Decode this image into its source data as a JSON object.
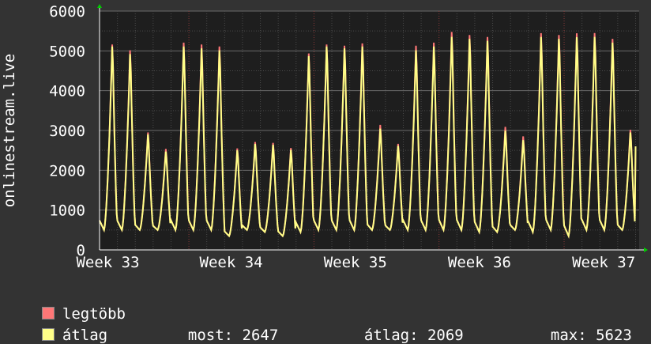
{
  "colors": {
    "background": "#333333",
    "plot_bg": "#1e1e1e",
    "grid": "#555555",
    "series_max": "#ff7777",
    "series_avg": "#ffff88",
    "arrow": "#00cc00"
  },
  "chart_data": {
    "type": "line",
    "ylabel": "onlinestream.live",
    "ylim": [
      0,
      6000
    ],
    "y_ticks": [
      "0",
      "1000",
      "2000",
      "3000",
      "4000",
      "5000",
      "6000"
    ],
    "x_ticks": [
      "Week 33",
      "Week 34",
      "Week 35",
      "Week 36",
      "Week 37"
    ],
    "x_unit": "day",
    "xlim": [
      0,
      30.2
    ],
    "grid": true,
    "legend_position": "bottom",
    "daily_peaks_max": [
      5350,
      5200,
      3050,
      2620,
      5400,
      5350,
      5300,
      2640,
      2800,
      2780,
      2650,
      5120,
      5350,
      5320,
      5380,
      3250,
      2750,
      5320,
      5400,
      5680,
      5600,
      5550,
      3200,
      2950,
      5650,
      5600,
      5650,
      5650,
      5500,
      3120
    ],
    "daily_peaks_avg": [
      5300,
      5100,
      3000,
      2550,
      5300,
      5250,
      5200,
      2590,
      2750,
      2730,
      2600,
      5050,
      5300,
      5250,
      5300,
      3150,
      2700,
      5200,
      5300,
      5550,
      5500,
      5450,
      3100,
      2850,
      5550,
      5500,
      5550,
      5550,
      5400,
      3050
    ],
    "daily_troughs": [
      500,
      500,
      500,
      500,
      500,
      500,
      500,
      350,
      500,
      450,
      350,
      450,
      500,
      500,
      500,
      500,
      500,
      500,
      500,
      500,
      500,
      450,
      450,
      500,
      450,
      500,
      350,
      500,
      500,
      500
    ],
    "series": [
      {
        "name": "legtöbb",
        "key": "max"
      },
      {
        "name": "átlag",
        "key": "avg"
      }
    ]
  },
  "legend": {
    "max_label": "legtöbb",
    "avg_label": "átlag",
    "most_label": "most:",
    "most_value": "2647",
    "atlag_label": "átlag:",
    "atlag_value": "2069",
    "max_stat_label": "max:",
    "max_stat_value": "5623"
  }
}
